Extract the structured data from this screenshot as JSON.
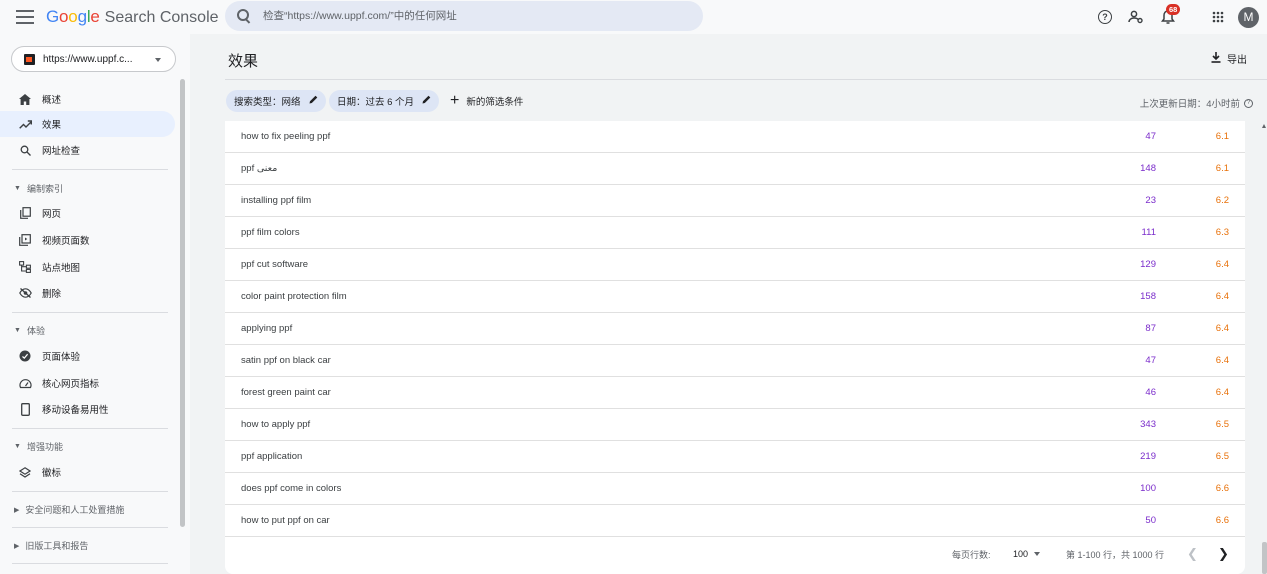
{
  "header": {
    "logo_google": "Google",
    "logo_product": "Search Console",
    "search_placeholder": "检查“https://www.uppf.com/”中的任何网址",
    "notification_count": "68",
    "avatar_initial": "M"
  },
  "sidebar": {
    "property": "https://www.uppf.c...",
    "top_items": [
      {
        "label": "概述",
        "icon": "home-icon"
      },
      {
        "label": "效果",
        "icon": "trending-up-icon"
      },
      {
        "label": "网址检查",
        "icon": "search-icon"
      }
    ],
    "sections": {
      "index": {
        "title": "编制索引",
        "items": [
          {
            "label": "网页",
            "icon": "pages-icon"
          },
          {
            "label": "视频页面数",
            "icon": "video-pages-icon"
          },
          {
            "label": "站点地图",
            "icon": "sitemap-icon"
          },
          {
            "label": "删除",
            "icon": "removals-icon"
          }
        ]
      },
      "experience": {
        "title": "体验",
        "items": [
          {
            "label": "页面体验",
            "icon": "page-experience-icon"
          },
          {
            "label": "核心网页指标",
            "icon": "speed-gauge-icon"
          },
          {
            "label": "移动设备易用性",
            "icon": "mobile-icon"
          }
        ]
      },
      "enhancements": {
        "title": "增强功能",
        "items": [
          {
            "label": "徽标",
            "icon": "layers-icon"
          }
        ]
      },
      "security": {
        "title": "安全问题和人工处置措施"
      },
      "legacy": {
        "title": "旧版工具和报告"
      }
    }
  },
  "main": {
    "title": "效果",
    "export_label": "导出",
    "filters": {
      "search_type": "搜索类型：网络",
      "date": "日期：过去 6 个月",
      "add_filter": "新的筛选条件"
    },
    "last_updated": "上次更新日期：4小时前",
    "rows": [
      {
        "query": "how to fix peeling ppf",
        "impressions": "47",
        "position": "6.1"
      },
      {
        "query": "ppf معنى",
        "impressions": "148",
        "position": "6.1"
      },
      {
        "query": "installing ppf film",
        "impressions": "23",
        "position": "6.2"
      },
      {
        "query": "ppf film colors",
        "impressions": "111",
        "position": "6.3"
      },
      {
        "query": "ppf cut software",
        "impressions": "129",
        "position": "6.4"
      },
      {
        "query": "color paint protection film",
        "impressions": "158",
        "position": "6.4"
      },
      {
        "query": "applying ppf",
        "impressions": "87",
        "position": "6.4"
      },
      {
        "query": "satin ppf on black car",
        "impressions": "47",
        "position": "6.4"
      },
      {
        "query": "forest green paint car",
        "impressions": "46",
        "position": "6.4"
      },
      {
        "query": "how to apply ppf",
        "impressions": "343",
        "position": "6.5"
      },
      {
        "query": "ppf application",
        "impressions": "219",
        "position": "6.5"
      },
      {
        "query": "does ppf come in colors",
        "impressions": "100",
        "position": "6.6"
      },
      {
        "query": "how to put ppf on car",
        "impressions": "50",
        "position": "6.6"
      }
    ],
    "pagination": {
      "rows_per_page_label": "每页行数:",
      "rows_per_page": "100",
      "range": "第 1-100 行，共 1000 行"
    }
  },
  "colors": {
    "impressions": "#7b2dcb",
    "position": "#e8710a",
    "accent": "#1a73e8"
  }
}
